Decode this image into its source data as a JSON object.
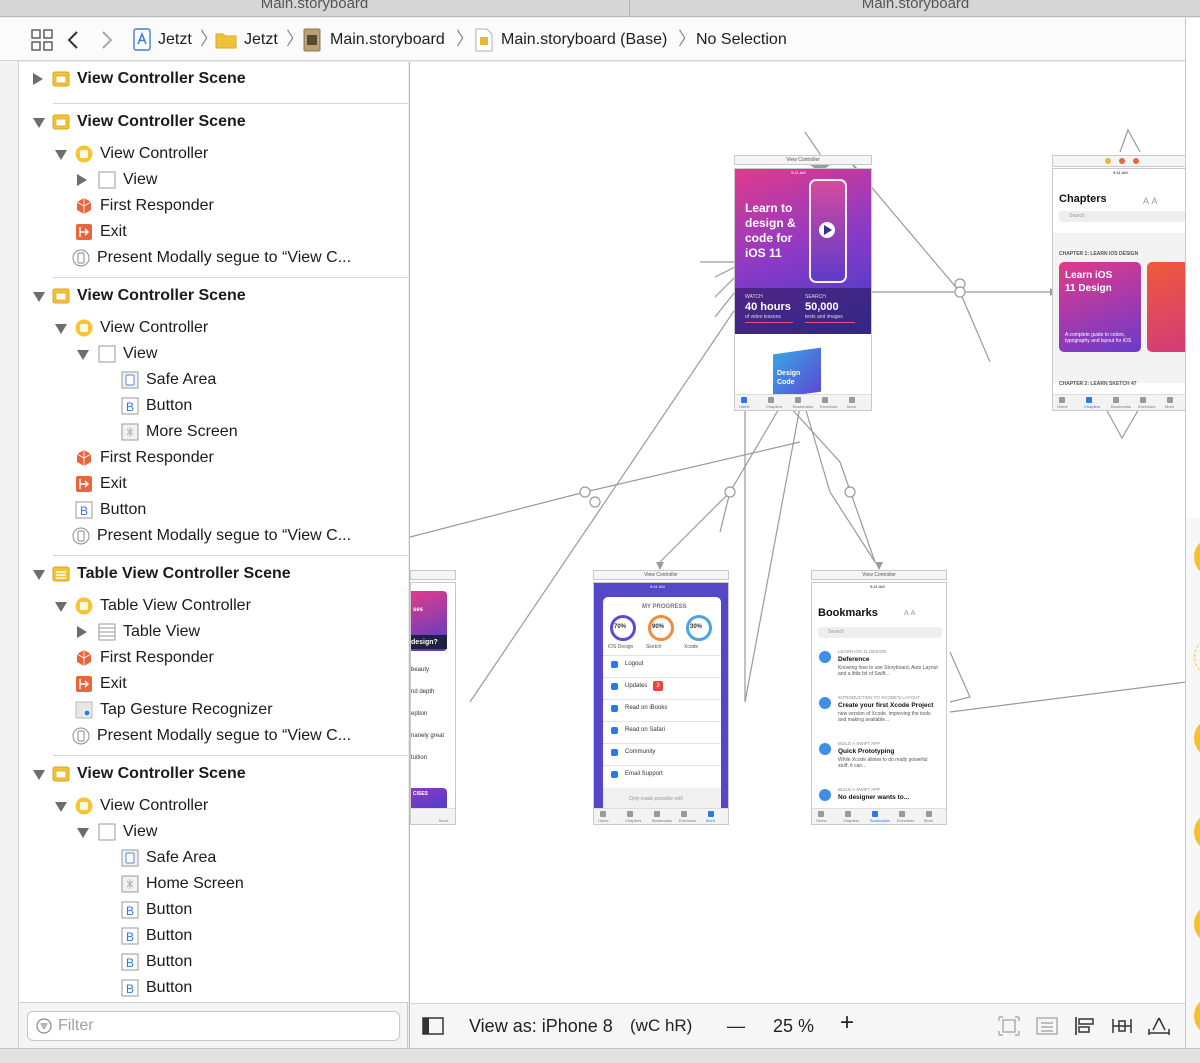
{
  "tabs": {
    "left": "Main.storyboard",
    "right": "Main.storyboard"
  },
  "jumpbar": {
    "crumbs": [
      "Jetzt",
      "Jetzt",
      "Main.storyboard",
      "Main.storyboard (Base)",
      "No Selection"
    ]
  },
  "outline": {
    "rows": [
      {
        "label": "View Controller Scene"
      },
      {
        "label": "View Controller Scene"
      },
      {
        "label": "View Controller"
      },
      {
        "label": "View"
      },
      {
        "label": "First Responder"
      },
      {
        "label": "Exit"
      },
      {
        "label": "Present Modally segue to “View C..."
      },
      {
        "label": "View Controller Scene"
      },
      {
        "label": "View Controller"
      },
      {
        "label": "View"
      },
      {
        "label": "Safe Area"
      },
      {
        "label": "Button"
      },
      {
        "label": "More Screen"
      },
      {
        "label": "First Responder"
      },
      {
        "label": "Exit"
      },
      {
        "label": "Button"
      },
      {
        "label": "Present Modally segue to “View C..."
      },
      {
        "label": "Table View Controller Scene"
      },
      {
        "label": "Table View Controller"
      },
      {
        "label": "Table View"
      },
      {
        "label": "First Responder"
      },
      {
        "label": "Exit"
      },
      {
        "label": "Tap Gesture Recognizer"
      },
      {
        "label": "Present Modally segue to “View C..."
      },
      {
        "label": "View Controller Scene"
      },
      {
        "label": "View Controller"
      },
      {
        "label": "View"
      },
      {
        "label": "Safe Area"
      },
      {
        "label": "Home Screen"
      },
      {
        "label": "Button"
      },
      {
        "label": "Button"
      },
      {
        "label": "Button"
      },
      {
        "label": "Button"
      }
    ]
  },
  "filter": {
    "placeholder": "Filter"
  },
  "bottombar": {
    "view_as": "View as: iPhone 8",
    "size_class": "(wC hR)",
    "zoom": "25 %",
    "minus": "—",
    "plus": "+"
  },
  "canvas": {
    "home": {
      "title": "View Controller",
      "time": "9:41 AM",
      "hero": "Learn to design & code for iOS 11",
      "stat1_label": "WATCH",
      "stat1_value": "40 hours",
      "stat1_sub": "of video lessons",
      "stat2_label": "SEARCH",
      "stat2_value": "50,000",
      "stat2_sub": "texts and images",
      "book": "Design Code",
      "tabs": [
        "Home",
        "Chapters",
        "Bookmarks",
        "Exercises",
        "More"
      ]
    },
    "chapters": {
      "time": "9:41 AM",
      "heading": "Chapters",
      "search": "Search",
      "section1": "CHAPTER 1: LEARN IOS DESIGN",
      "card_title": "Learn iOS 11 Design",
      "card_sub": "A complete guide to colors, typography and layout for iOS",
      "section2": "CHAPTER 2: LEARN SKETCH 47",
      "tabs": [
        "Home",
        "Chapters",
        "Bookmarks",
        "Exercises",
        "More"
      ]
    },
    "more": {
      "title": "View Controller",
      "time": "9:41 AM",
      "progress": "MY PROGRESS",
      "rings": [
        {
          "pct": "70%",
          "label": "iOS Design",
          "color": "#5b4bd4"
        },
        {
          "pct": "90%",
          "label": "Sketch",
          "color": "#f08b3a"
        },
        {
          "pct": "30%",
          "label": "Xcode",
          "color": "#4aa3e6"
        }
      ],
      "items": [
        "Logout",
        "Updates",
        "Read on iBooks",
        "Read on Safari",
        "Community",
        "Email Support"
      ],
      "badge": "3",
      "footer": "Only made possible with",
      "tabs": [
        "Home",
        "Chapters",
        "Bookmarks",
        "Exercises",
        "More"
      ]
    },
    "bookmarks": {
      "title": "View Controller",
      "time": "9:41 AM",
      "heading": "Bookmarks",
      "search": "Search",
      "items": [
        {
          "section": "LEARN IOS 11 DESIGN",
          "title": "Deference",
          "body": "Knowing how to use Storyboard, Auto Layout and a little bit of Swift..."
        },
        {
          "section": "INTRODUCTION TO XCODE'S LAYOUT",
          "title": "Create your first Xcode Project",
          "body": "new version of Xcode, improving the tools and making available..."
        },
        {
          "section": "BUILD A SWIFT APP",
          "title": "Quick Prototyping",
          "body": "While Xcode allows to do really powerful stuff, it can..."
        },
        {
          "section": "BUILD A SWIFT APP",
          "title": "No designer wants to..."
        }
      ],
      "tabs": [
        "Home",
        "Chapters",
        "Bookmarks",
        "Exercises",
        "More"
      ]
    },
    "partial": {
      "lines": [
        "ses",
        "design?",
        "beauty",
        "nd depth",
        "eption",
        "nanely great",
        "tuition",
        "CISES"
      ],
      "tabs": [
        "",
        "More"
      ]
    }
  },
  "colors": {
    "accent": "#2b79e3",
    "scene_icon": "#f5c535",
    "responder": "#e8663c",
    "heroGradientA": "#e53b8f",
    "heroGradientB": "#4d3ec9"
  }
}
